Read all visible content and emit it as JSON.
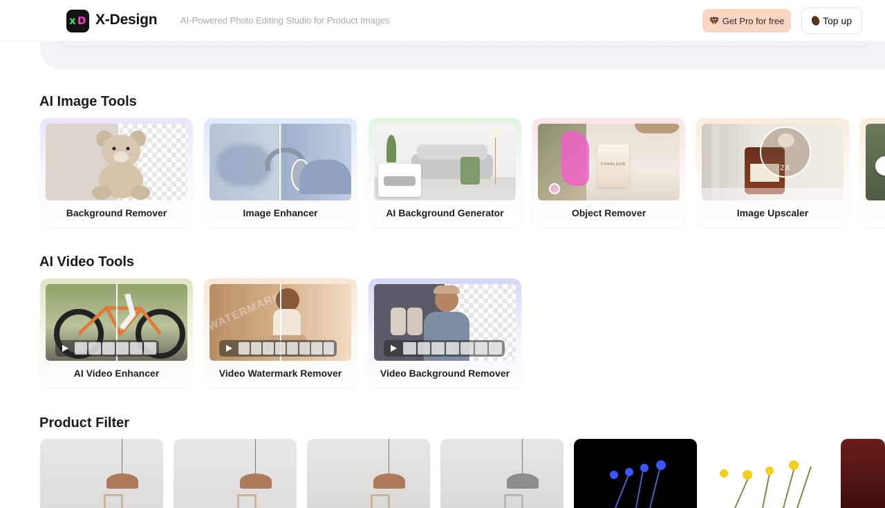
{
  "header": {
    "brand": "X-Design",
    "logo_letters": {
      "x": "x",
      "d": "D"
    },
    "tagline": "AI-Powered Photo Editing Studio for Product Images",
    "pro_button": "Get Pro for free",
    "topup_button": "Top up"
  },
  "sections": {
    "image_tools_title": "AI Image Tools",
    "video_tools_title": "AI Video Tools",
    "product_filter_title": "Product Filter"
  },
  "image_tools": [
    {
      "label": "Background Remover"
    },
    {
      "label": "Image Enhancer"
    },
    {
      "label": "AI Background Generator"
    },
    {
      "label": "Object Remover"
    },
    {
      "label": "Image Upscaler",
      "badge": "2X"
    }
  ],
  "video_tools": [
    {
      "label": "AI Video Enhancer"
    },
    {
      "label": "Video Watermark Remover",
      "watermark_text": "WATERMARK"
    },
    {
      "label": "Video Background Remover"
    }
  ],
  "candle_label": "CHARLOOR",
  "colors": {
    "pro_bg": "#fbd5c3",
    "accent_green": "#3ee06a",
    "accent_pink": "#ff3bd1"
  }
}
